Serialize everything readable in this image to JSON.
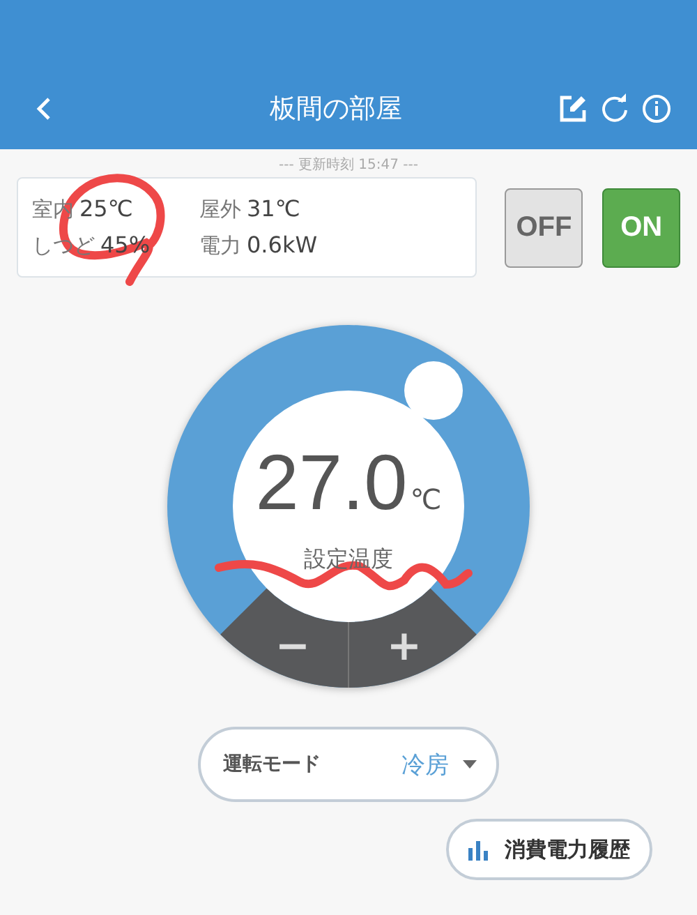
{
  "header": {
    "title": "板間の部屋"
  },
  "update_time": "--- 更新時刻 15:47 ---",
  "readings": [
    {
      "label": "室内",
      "value": "25℃"
    },
    {
      "label": "屋外",
      "value": "31℃"
    },
    {
      "label": "しつど",
      "value": "45%"
    },
    {
      "label": "電力",
      "value": "0.6kW"
    }
  ],
  "power_buttons": [
    {
      "label": "OFF",
      "selected": false
    },
    {
      "label": "ON",
      "selected": true
    }
  ],
  "dial": {
    "value": "27.0",
    "unit": "℃",
    "caption": "設定温度",
    "minus": "−",
    "plus": "+"
  },
  "mode": {
    "label": "運転モード",
    "value": "冷房"
  },
  "history_button": {
    "label": "消費電力履歴"
  }
}
